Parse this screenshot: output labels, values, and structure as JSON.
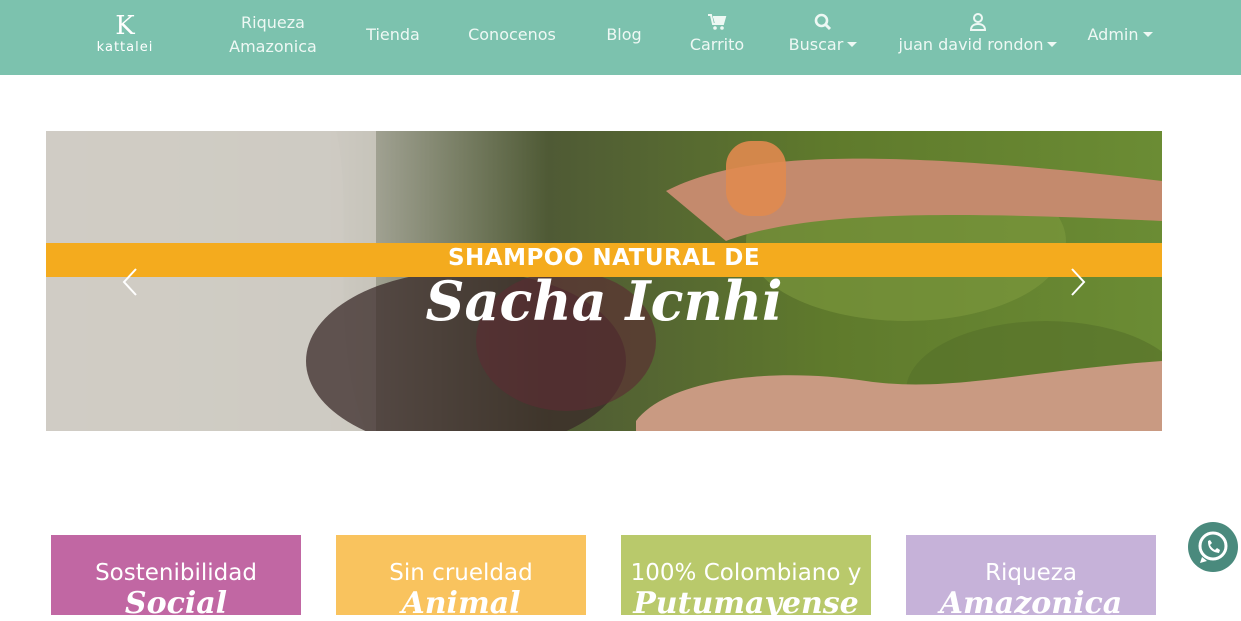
{
  "brand": {
    "name": "kattalei",
    "mark": "K"
  },
  "nav": {
    "riqueza": "Riqueza Amazonica",
    "tienda": "Tienda",
    "conocenos": "Conocenos",
    "blog": "Blog",
    "carrito": "Carrito",
    "buscar": "Buscar",
    "user": "juan david rondon",
    "admin": "Admin"
  },
  "banner": {
    "line1": "SHAMPOO NATURAL DE",
    "line2": "Sacha Icnhi"
  },
  "cards": [
    {
      "line1": "Sostenibilidad",
      "line2": "Social",
      "color": "#c167a3"
    },
    {
      "line1": "Sin crueldad",
      "line2": "Animal",
      "color": "#f9c35e"
    },
    {
      "line1": "100% Colombiano y",
      "line2": "Putumayense",
      "color": "#b9c96b"
    },
    {
      "line1": "Riqueza",
      "line2": "Amazonica",
      "color": "#c6b2d9"
    }
  ],
  "colors": {
    "navbar": "#7cc2ae",
    "band": "#f4ab1e",
    "whatsapp": "#4a8a7d"
  },
  "icons": [
    "cart-icon",
    "search-icon",
    "user-icon",
    "chevron-left-icon",
    "chevron-right-icon",
    "whatsapp-icon"
  ]
}
